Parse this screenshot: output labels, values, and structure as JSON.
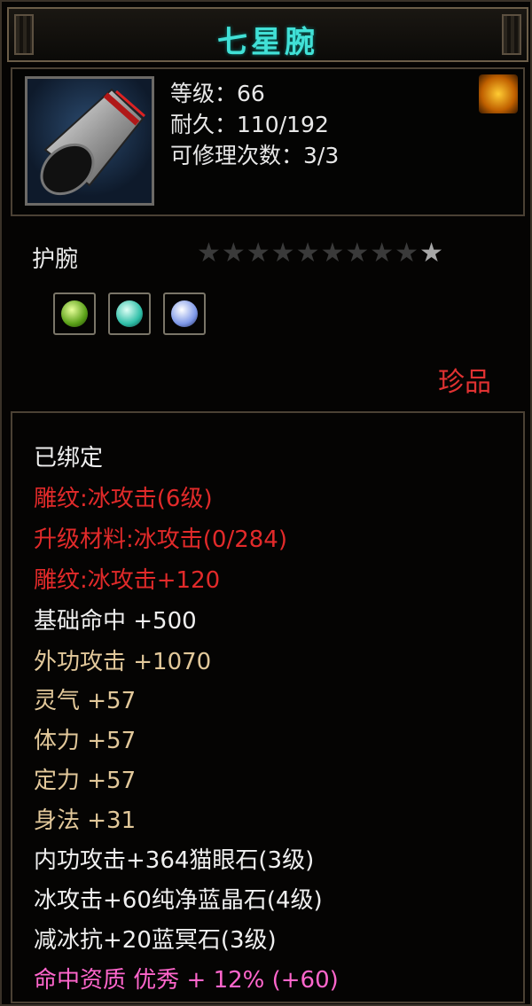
{
  "item": {
    "name": "七星腕",
    "type": "护腕",
    "quality": "珍品",
    "icon": "bracer-icon",
    "stars_total": 10,
    "stars_lit": 1
  },
  "stats": [
    {
      "label": "等级：66"
    },
    {
      "label": "耐久：110/192"
    },
    {
      "label": "可修理次数：3/3"
    }
  ],
  "gems": [
    {
      "name": "green-gem-icon",
      "color": "#9fe03a"
    },
    {
      "name": "cyan-gem-icon",
      "color": "#54e0c8"
    },
    {
      "name": "blue-gem-icon",
      "color": "#9fb6ff"
    }
  ],
  "attributes": [
    {
      "text": "已绑定",
      "color": "white"
    },
    {
      "text": "雕纹:冰攻击(6级)",
      "color": "red"
    },
    {
      "text": "升级材料:冰攻击(0/284)",
      "color": "red"
    },
    {
      "text": "雕纹:冰攻击+120",
      "color": "red"
    },
    {
      "text": "基础命中  +500",
      "color": "white"
    },
    {
      "text": "外功攻击  +1070",
      "color": "gold"
    },
    {
      "text": "灵气  +57",
      "color": "gold"
    },
    {
      "text": "体力  +57",
      "color": "gold"
    },
    {
      "text": "定力  +57",
      "color": "gold"
    },
    {
      "text": "身法  +31",
      "color": "gold"
    },
    {
      "text": "内功攻击+364猫眼石(3级)",
      "color": "white"
    },
    {
      "text": "冰攻击+60纯净蓝晶石(4级)",
      "color": "white"
    },
    {
      "text": "减冰抗+20蓝冥石(3级)",
      "color": "white"
    },
    {
      "text": "命中资质  优秀  +  12%  (+60)",
      "color": "pink"
    }
  ],
  "colors": {
    "title": "#41e0d6",
    "quality": "#e03232",
    "red": "#e22a2a",
    "gold": "#e2c89a",
    "pink": "#ff66cc"
  }
}
